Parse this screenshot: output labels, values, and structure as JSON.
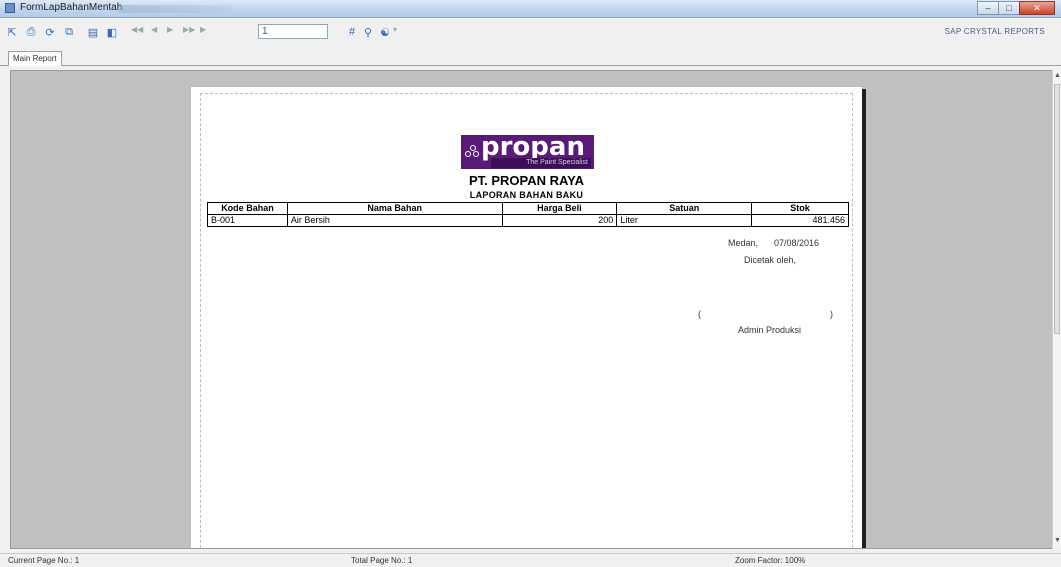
{
  "window": {
    "title": "FormLapBahanMentah",
    "controls": [
      "minimize",
      "maximize",
      "close"
    ]
  },
  "toolbar": {
    "page_field_value": "1",
    "brand": "SAP CRYSTAL REPORTS"
  },
  "tabs": [
    {
      "label": "Main Report"
    }
  ],
  "report": {
    "logo_word": "propan",
    "logo_tagline": "The Paint Specialist",
    "company": "PT. PROPAN RAYA",
    "title": "LAPORAN BAHAN BAKU",
    "columns": [
      "Kode Bahan",
      "Nama Bahan",
      "Harga Beli",
      "Satuan",
      "Stok"
    ],
    "rows": [
      [
        "B-001",
        "Air Bersih",
        "200",
        "Liter",
        "481.456"
      ]
    ],
    "signature": {
      "city": "Medan,",
      "date": "07/08/2016",
      "printed_by": "Dicetak oleh,",
      "open_paren": "(",
      "close_paren": ")",
      "name": "Admin Produksi"
    }
  },
  "statusbar": {
    "current_page": "Current Page No.: 1",
    "total_page": "Total Page No.: 1",
    "zoom": "Zoom Factor: 100%"
  }
}
